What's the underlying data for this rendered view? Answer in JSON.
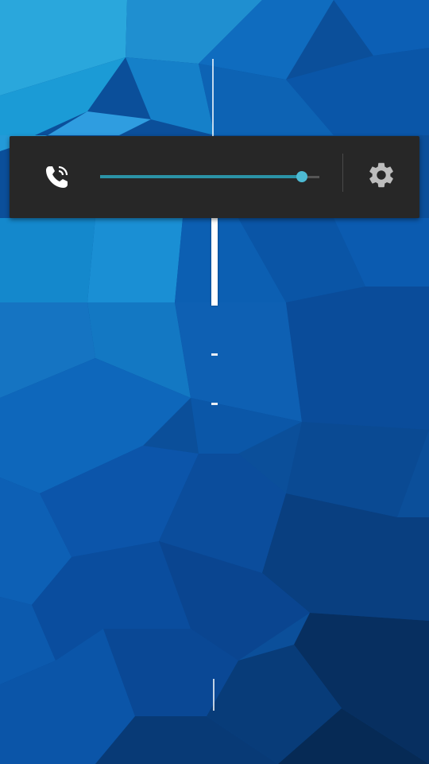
{
  "wallpaper": {
    "style": "low-poly blue"
  },
  "volume_panel": {
    "stream_icon": "phone-in-call-icon",
    "settings_icon": "gear-icon",
    "level": 0.92,
    "colors": {
      "panel": "#272727",
      "slider_fill": "#2b93a7",
      "slider_thumb": "#4dbad3"
    }
  }
}
